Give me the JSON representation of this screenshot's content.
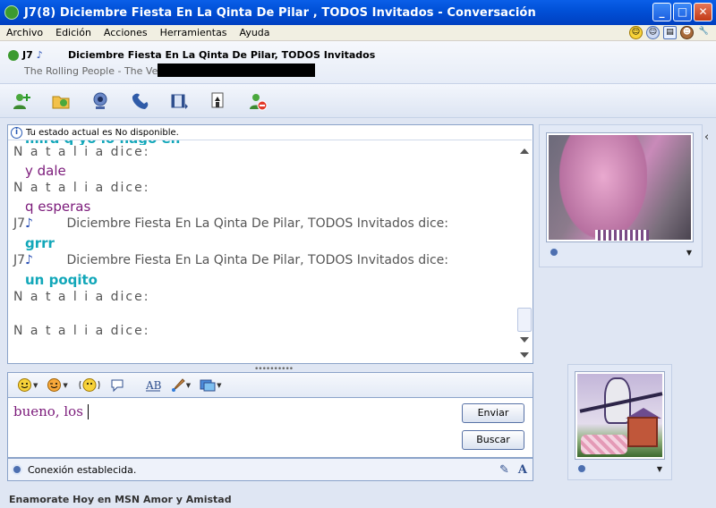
{
  "window": {
    "title": "J7(8)     Diciembre Fiesta En La Qinta De Pilar , TODOS Invitados - Conversación",
    "buttons": {
      "minimize": "_",
      "maximize": "□",
      "close": "✕"
    }
  },
  "menu": [
    "Archivo",
    "Edición",
    "Acciones",
    "Herramientas",
    "Ayuda"
  ],
  "header": {
    "self_name": "J7",
    "contact_name": "Diciembre Fiesta En La Qinta De Pilar, TODOS Invitados",
    "now_playing": "The Rolling People - The Verve"
  },
  "toolbar_icons": [
    "invite-contact-icon",
    "send-files-icon",
    "webcam-icon",
    "voice-call-icon",
    "activities-icon",
    "games-icon",
    "block-icon"
  ],
  "status_note": "Tu estado actual es No disponible.",
  "conversation": [
    {
      "type": "msg",
      "style": "teal",
      "text": "mira q yo lo hago en"
    },
    {
      "type": "speaker",
      "text": "N a t a l i a  dice:"
    },
    {
      "type": "msg",
      "style": "purple",
      "text": "y dale"
    },
    {
      "type": "speaker",
      "text": "N a t a l i a  dice:"
    },
    {
      "type": "msg",
      "style": "purple",
      "text": "q esperas"
    },
    {
      "type": "speaker_long",
      "prefix": "J7",
      "text": "Diciembre Fiesta En La Qinta De Pilar, TODOS Invitados dice:"
    },
    {
      "type": "msg",
      "style": "teal",
      "text": "grrr"
    },
    {
      "type": "speaker_long",
      "prefix": "J7",
      "text": "Diciembre Fiesta En La Qinta De Pilar, TODOS Invitados dice:"
    },
    {
      "type": "msg",
      "style": "teal",
      "text": "un poqito"
    },
    {
      "type": "speaker",
      "text": "N a t a l i a  dice:"
    },
    {
      "type": "blank",
      "text": ""
    },
    {
      "type": "speaker",
      "text": "N a t a l i a  dice:"
    }
  ],
  "format_toolbar": [
    "emoticon-icon",
    "wink-icon",
    "nudge-icon",
    "voice-clip-icon",
    "font-icon",
    "background-icon",
    "display-picture-icon"
  ],
  "compose": {
    "text": "bueno, los",
    "send_label": "Enviar",
    "search_label": "Buscar"
  },
  "statusbar": {
    "text": "Conexión establecida."
  },
  "ad": "Enamorate Hoy en MSN Amor y Amistad"
}
